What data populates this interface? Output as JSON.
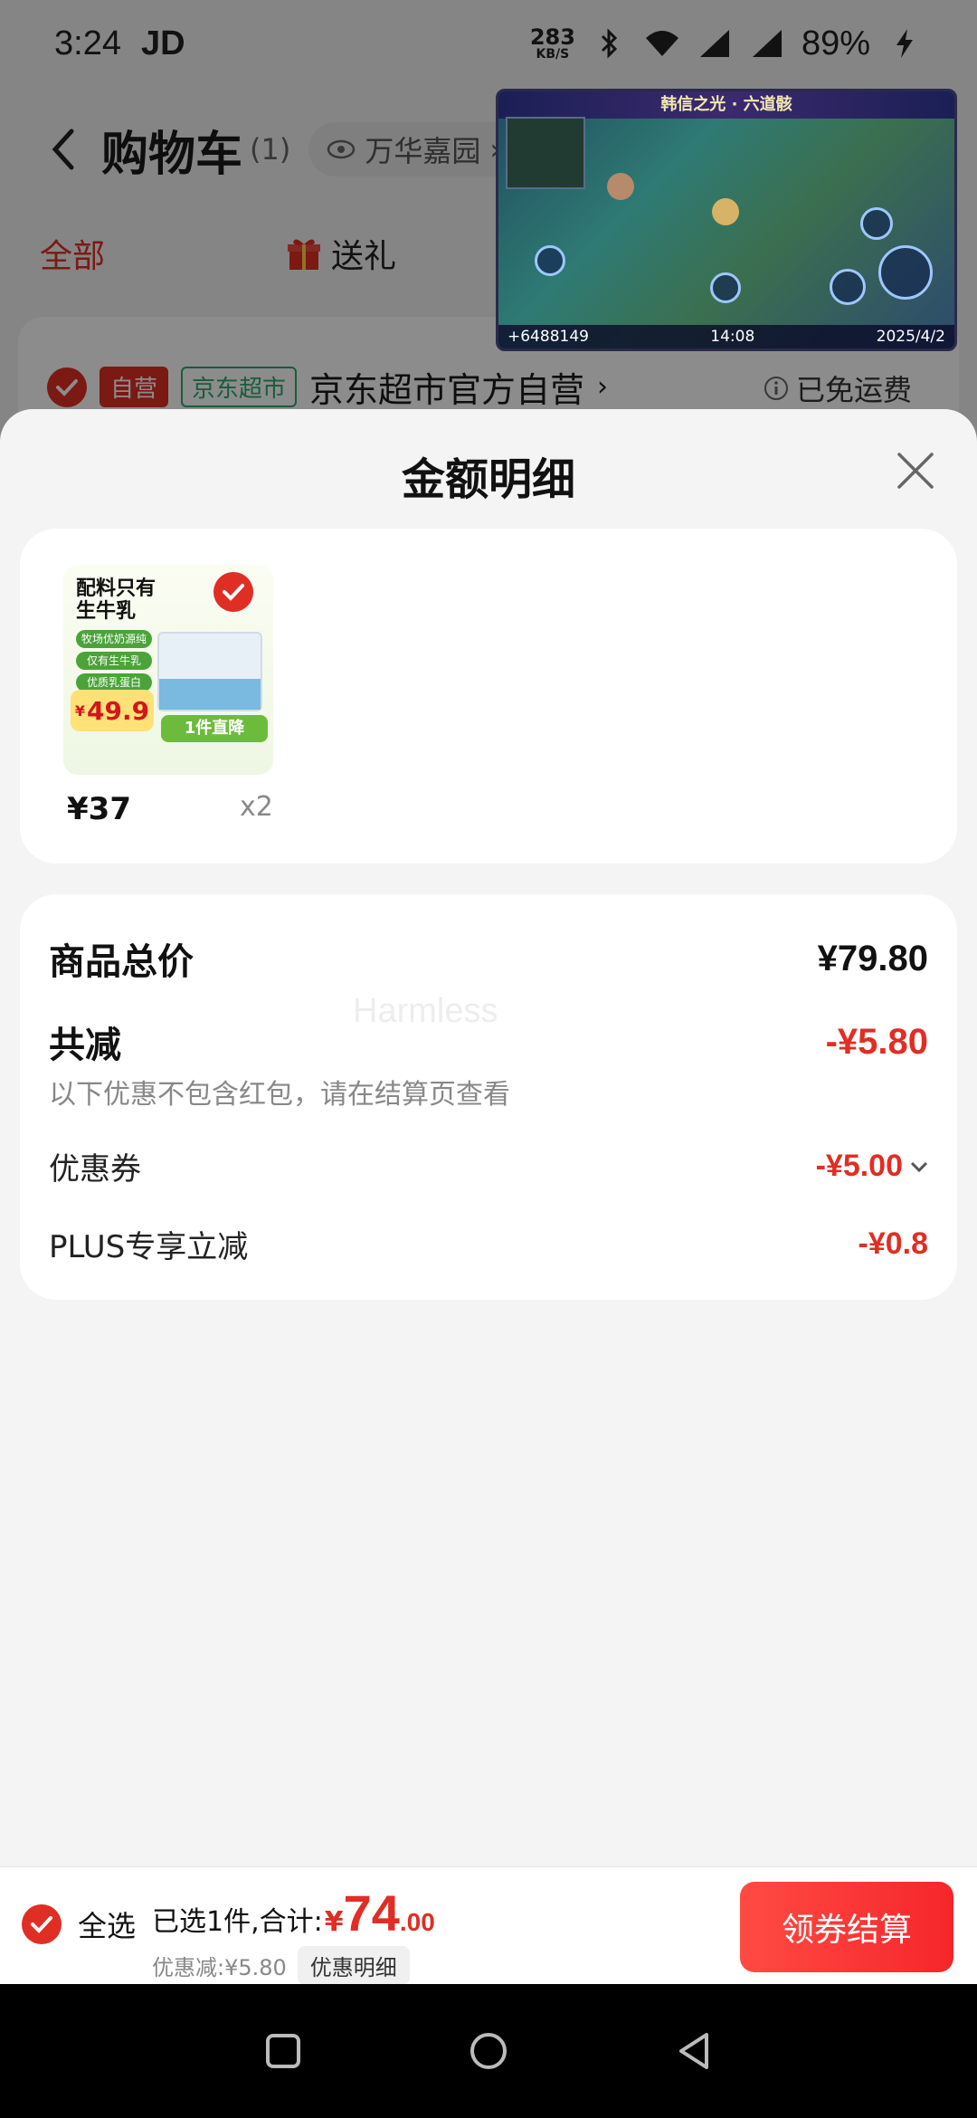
{
  "status_bar": {
    "time": "3:24",
    "carrier": "JD",
    "net_speed": "283",
    "net_unit": "KB/S",
    "battery": "89%"
  },
  "cart_header": {
    "title": "购物车",
    "count": "(1)",
    "location": "万华嘉园"
  },
  "cart_tabs": {
    "all": "全部",
    "gift": "送礼"
  },
  "store": {
    "tag_self": "自营",
    "tag_market": "京东超市",
    "name": "京东超市官方自营",
    "shipping": "已免运费"
  },
  "video_overlay": {
    "title": "韩信之光 · 六道骸",
    "score": "+6488149",
    "time": "14:08",
    "date": "2025/4/2"
  },
  "sheet": {
    "title": "金额明细",
    "product": {
      "thumb_line1": "配料只有",
      "thumb_line2": "生牛乳",
      "thumb_pill1": "牧场优奶源纯",
      "thumb_pill2": "仅有生牛乳",
      "thumb_pill3": "优质乳蛋白",
      "thumb_price": "49.9",
      "thumb_currency": "¥",
      "thumb_banner": "1件直降",
      "price": "¥37",
      "qty": "x2"
    },
    "summary": {
      "total_label": "商品总价",
      "total_value": "¥79.80",
      "discount_label": "共减",
      "discount_value": "-¥5.80",
      "note": "以下优惠不包含红包，请在结算页查看",
      "coupon_label": "优惠券",
      "coupon_value": "-¥5.00",
      "plus_label": "PLUS专享立减",
      "plus_value": "-¥0.8",
      "watermark": "Harmless"
    }
  },
  "checkout": {
    "select_all": "全选",
    "selected_text": "已选1件,合计:",
    "currency": "¥",
    "amount_int": "74",
    "amount_dec": ".00",
    "saved": "优惠减:¥5.80",
    "detail_chip": "优惠明细",
    "button": "领券结算"
  },
  "colors": {
    "accent_red": "#e02e24",
    "tag_green": "#2fa86c"
  }
}
